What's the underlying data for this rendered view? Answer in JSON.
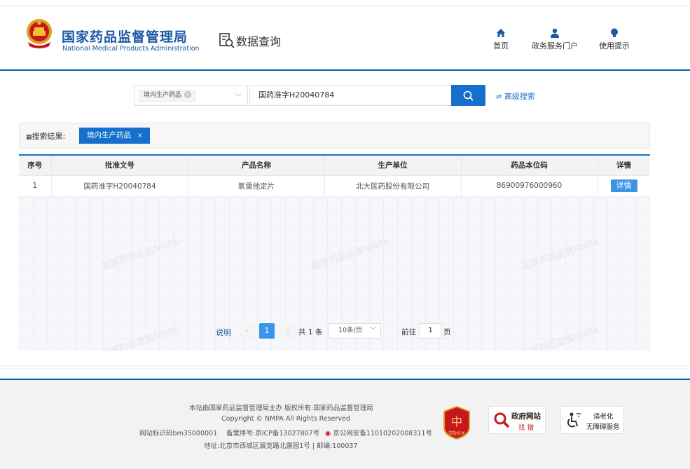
{
  "header": {
    "org_name_cn": "国家药品监督管理局",
    "org_name_en": "National Medical Products Administration",
    "section_title": "数据查询",
    "nav": [
      {
        "label": "首页",
        "icon": "home-icon"
      },
      {
        "label": "政务服务门户",
        "icon": "user-icon"
      },
      {
        "label": "使用提示",
        "icon": "bulb-icon"
      }
    ]
  },
  "search": {
    "category_tag": "境内生产药品",
    "query": "国药准字H20040784",
    "advanced_label": "高级搜索"
  },
  "results": {
    "label": "搜索结果:",
    "filter_tag": "境内生产药品",
    "columns": [
      "序号",
      "批准文号",
      "产品名称",
      "生产单位",
      "药品本位码",
      "详情"
    ],
    "rows": [
      {
        "index": "1",
        "approval_no": "国药准字H20040784",
        "product": "氯雷他定片",
        "manufacturer": "北大医药股份有限公司",
        "drug_code": "86900976000960",
        "detail_label": "详情"
      }
    ],
    "watermark": "国家药品监督NMPA"
  },
  "pagination": {
    "explain": "说明",
    "prev": "‹",
    "current_page": "1",
    "next": "›",
    "total": "共 1 条",
    "page_size": "10条/页",
    "goto_label": "前往",
    "goto_value": "1",
    "page_suffix": "页"
  },
  "footer": {
    "line1": "本站由国家药品监督管理局主办 版权所有:国家药品监督管理局",
    "line2": "Copyright © NMPA All Rights Reserved",
    "site_id": "网站标识码bm35000001",
    "icp": "备案序号:京ICP备13027807号",
    "police": "京公网安备11010202008311号",
    "address": "地址:北京市西城区展览路北露园1号 | 邮编:100037",
    "badge_gov_title": "政府网站",
    "badge_gov_sub": "找 错",
    "badge_access_title": "适老化",
    "badge_access_sub": "无障碍服务",
    "badge_dzjg": "党政机关"
  },
  "colors": {
    "brand_blue": "#1b58a8",
    "accent_blue": "#1470cc",
    "button_blue": "#3a95e8"
  }
}
